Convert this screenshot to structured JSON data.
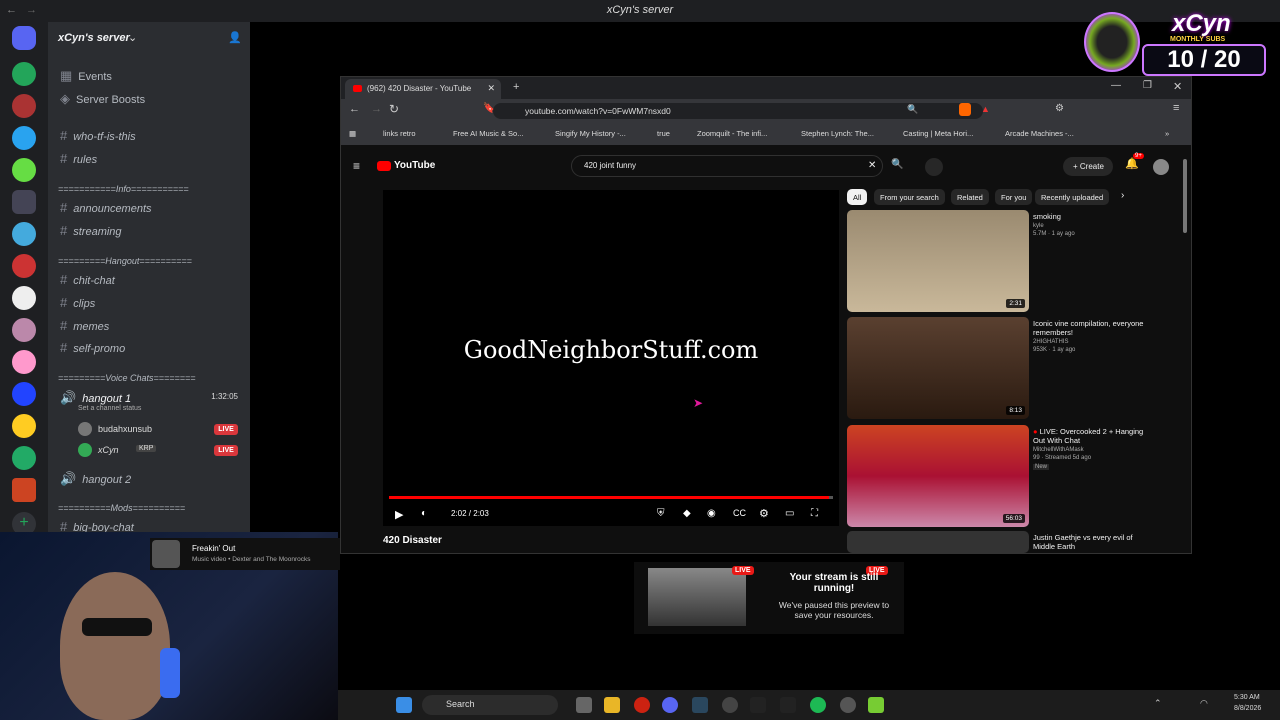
{
  "titlebar": {
    "title": "xCyn's server"
  },
  "overlay": {
    "brand": "xCyn",
    "caption": "MONTHLY SUBS",
    "count": "10 / 20"
  },
  "server": {
    "name": "xCyn's server",
    "links": [
      "Events",
      "Server Boosts"
    ],
    "channels_top": [
      "who-tf-is-this",
      "rules"
    ],
    "cat_info": "===========Info===========",
    "channels_info": [
      "announcements",
      "streaming"
    ],
    "cat_hangout": "=========Hangout==========",
    "channels_hangout": [
      "chit-chat",
      "clips",
      "memes",
      "self-promo"
    ],
    "cat_voice": "=========Voice Chats========",
    "voice1": {
      "name": "hangout 1",
      "status": "Set a channel status",
      "time": "1:32:05"
    },
    "voice_users": [
      {
        "name": "budahxunsub",
        "live": "LIVE"
      },
      {
        "name": "xCyn",
        "tag": "KRP",
        "live": "LIVE"
      }
    ],
    "voice2": "hangout 2",
    "cat_mods": "==========Mods==========",
    "channel_mods": "big-boy-chat"
  },
  "music": {
    "title": "Freakin' Out",
    "subtitle": "Music video • Dexter and The Moonrocks"
  },
  "browser": {
    "tab_title": "(962) 420 Disaster - YouTube",
    "url": "youtube.com/watch?v=0FwWM7nsxd0",
    "bookmarks": [
      "links retro",
      "Free AI Music & So...",
      "Singify My History -...",
      "true",
      "Zoomquilt - The infi...",
      "Stephen Lynch: The...",
      "Casting | Meta Hori...",
      "Arcade Machines -..."
    ]
  },
  "youtube": {
    "logo": "YouTube",
    "search": "420 joint funny",
    "create": "Create",
    "notif": "9+",
    "video_watermark": "GoodNeighborStuff.com",
    "time": "2:02 / 2:03",
    "progress": 0.99,
    "video_title": "420 Disaster",
    "chips": [
      "All",
      "From your search",
      "Related",
      "For you",
      "Recently uploaded"
    ],
    "recs": [
      {
        "title": "smoking",
        "channel": "kyle",
        "meta": "5.7M · 1 ay ago",
        "duration": "2:31"
      },
      {
        "title": "Iconic vine compilation, everyone remembers!",
        "channel": "2HIGHATHIS",
        "meta": "953K · 1 ay ago",
        "duration": "8:13"
      },
      {
        "title": "LIVE: Overcooked 2 + Hanging Out With Chat",
        "channel": "MitchellWithAMask",
        "meta": "99 · Streamed 5d ago",
        "badge": "New",
        "duration": "56:03"
      },
      {
        "title": "Justin Gaethje vs every evil of Middle Earth",
        "channel": "",
        "meta": "",
        "duration": ""
      }
    ]
  },
  "stream_notice": {
    "live": "LIVE",
    "title": "Your stream is still running!",
    "body": "We've paused this preview to save your resources."
  },
  "taskbar": {
    "search": "Search",
    "time": "5:30 AM",
    "date": "8/8/2026"
  },
  "colors": {
    "accent": "#ff0000",
    "discord_bg": "#2b2d31",
    "live": "#da373c"
  }
}
